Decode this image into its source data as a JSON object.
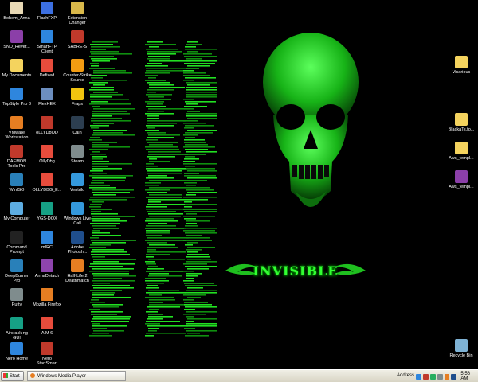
{
  "desktop": {
    "icons": [
      {
        "label": "Bohem_Anna",
        "icon": "image-file-icon",
        "color": "#e8d9b5"
      },
      {
        "label": "FlashFXP",
        "icon": "flashfxp-icon",
        "color": "#3c6fe0"
      },
      {
        "label": "Extension Changer",
        "icon": "extension-changer-icon",
        "color": "#d9b84a"
      },
      {
        "label": "SND_Rever...",
        "icon": "rar-archive-icon",
        "color": "#8b3fa8"
      },
      {
        "label": "SmartFTP Client",
        "icon": "smartftp-icon",
        "color": "#2e86de"
      },
      {
        "label": "SABRE-S",
        "icon": "sabre-icon",
        "color": "#c0392b"
      },
      {
        "label": "My Documents",
        "icon": "my-documents-icon",
        "color": "#f4d35e"
      },
      {
        "label": "Defixed",
        "icon": "defixed-icon",
        "color": "#e74c3c"
      },
      {
        "label": "Counter-Strike Source",
        "icon": "counter-strike-icon",
        "color": "#f39c12"
      },
      {
        "label": "TopStyle Pro 3",
        "icon": "topstyle-icon",
        "color": "#2e86de"
      },
      {
        "label": "FlexHEX",
        "icon": "flexhex-icon",
        "color": "#6c8ebf"
      },
      {
        "label": "Fraps",
        "icon": "fraps-icon",
        "color": "#f1c40f"
      },
      {
        "label": "VMware Workstation",
        "icon": "vmware-icon",
        "color": "#e67e22"
      },
      {
        "label": "oLLYDbOD",
        "icon": "ollydbg-red-icon",
        "color": "#c0392b"
      },
      {
        "label": "Cain",
        "icon": "cain-icon",
        "color": "#2c3e50"
      },
      {
        "label": "DAEMON Tools Pro",
        "icon": "daemon-tools-icon",
        "color": "#c0392b"
      },
      {
        "label": "OllyDbg",
        "icon": "ollydbg-icon",
        "color": "#e74c3c"
      },
      {
        "label": "Steam",
        "icon": "steam-icon",
        "color": "#7f8c8d"
      },
      {
        "label": "WinISO",
        "icon": "winiso-icon",
        "color": "#2980b9"
      },
      {
        "label": "OLLYDBG_E...",
        "icon": "ollydbg-e-icon",
        "color": "#e74c3c"
      },
      {
        "label": "Ventrilo",
        "icon": "ventrilo-icon",
        "color": "#3498db"
      },
      {
        "label": "My Computer",
        "icon": "my-computer-icon",
        "color": "#5dade2"
      },
      {
        "label": "YGS-DOX",
        "icon": "ygs-dox-icon",
        "color": "#16a085"
      },
      {
        "label": "Windows Live Call",
        "icon": "windows-live-call-icon",
        "color": "#3498db"
      },
      {
        "label": "Command Prompt",
        "icon": "command-prompt-icon",
        "color": "#222222"
      },
      {
        "label": "mIRC",
        "icon": "mirc-icon",
        "color": "#2e86de"
      },
      {
        "label": "Adobe Photosh...",
        "icon": "photoshop-icon",
        "color": "#1f4e8c"
      },
      {
        "label": "DeepBurner Pro",
        "icon": "deepburner-icon",
        "color": "#2980b9"
      },
      {
        "label": "ArmaDetach",
        "icon": "armadetach-icon",
        "color": "#8e44ad"
      },
      {
        "label": "Half-Life 2 Deathmatch",
        "icon": "half-life-icon",
        "color": "#e67e22"
      },
      {
        "label": "Putty",
        "icon": "putty-icon",
        "color": "#7f8c8d"
      },
      {
        "label": "Mozilla Firefox",
        "icon": "firefox-icon",
        "color": "#e67e22"
      },
      {
        "label": "Aircrack-ng GUI",
        "icon": "aircrack-icon",
        "color": "#16a085"
      },
      {
        "label": "AIM 6",
        "icon": "aim-icon",
        "color": "#e74c3c"
      },
      {
        "label": "Nero Home",
        "icon": "nero-home-icon",
        "color": "#2e86de"
      },
      {
        "label": "Nero StartSmart",
        "icon": "nero-startsmart-icon",
        "color": "#c0392b"
      },
      {
        "label": "Vicarious",
        "icon": "folder-icon",
        "color": "#f4d35e"
      },
      {
        "label": "BlackaTs.fo...",
        "icon": "folder-icon",
        "color": "#f4d35e"
      },
      {
        "label": "Aws_templ...",
        "icon": "folder-icon",
        "color": "#f4d35e"
      },
      {
        "label": "Aws_templ...",
        "icon": "rar-archive-icon",
        "color": "#8b3fa8"
      },
      {
        "label": "Recycle Bin",
        "icon": "recycle-bin-icon",
        "color": "#7fb3d5"
      }
    ],
    "wallpaper": {
      "logo_text": "INVISIBLE",
      "accent": "#00ff00"
    }
  },
  "taskbar": {
    "start_label": "Start",
    "tasks": [
      {
        "label": "Windows Media Player",
        "icon": "media-player-icon"
      }
    ],
    "address_label": "Address",
    "clock": "5:56 AM"
  }
}
